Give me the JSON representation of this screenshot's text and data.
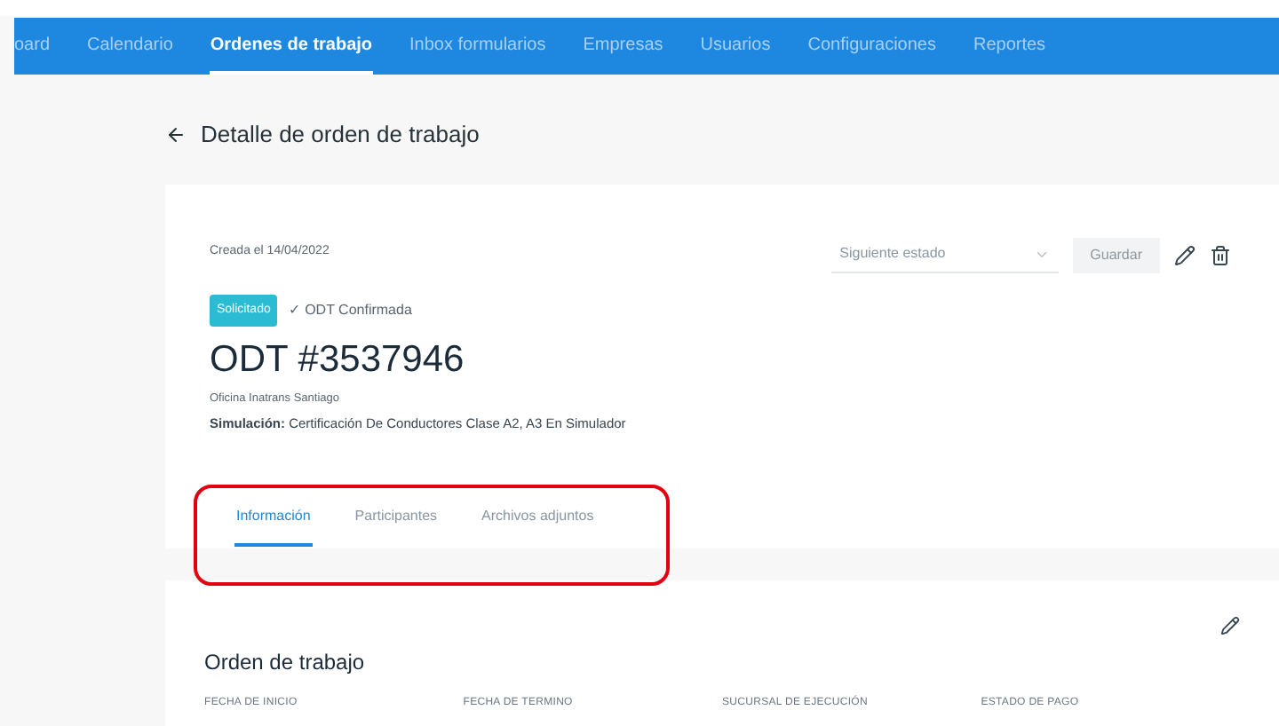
{
  "nav": {
    "items": [
      {
        "label": "oard",
        "selected": false
      },
      {
        "label": "Calendario",
        "selected": false
      },
      {
        "label": "Ordenes de trabajo",
        "selected": true
      },
      {
        "label": "Inbox formularios",
        "selected": false
      },
      {
        "label": "Empresas",
        "selected": false
      },
      {
        "label": "Usuarios",
        "selected": false
      },
      {
        "label": "Configuraciones",
        "selected": false
      },
      {
        "label": "Reportes",
        "selected": false
      }
    ]
  },
  "page_title": "Detalle de orden de trabajo",
  "order": {
    "created": "Creada el 14/04/2022",
    "status_badge": "Solicitado",
    "confirmation": "✓ ODT Confirmada",
    "number": "ODT #3537946",
    "office": "Oficina Inatrans Santiago",
    "simulation": "**Simulación:** Certificación De Conductores Clase A2, A3 En Simulador",
    "next_state": {
      "placeholder": "Siguiente estado"
    },
    "save_button": {
      "label": "Guardar",
      "disabled": true
    },
    "tabs": [
      {
        "label": "Información",
        "selected": true
      },
      {
        "label": "Participantes",
        "selected": false
      },
      {
        "label": "Archivos adjuntos",
        "selected": false
      }
    ]
  },
  "work_order": {
    "title": "Orden de trabajo",
    "fields": [
      "FECHA DE INICIO",
      "FECHA DE TERMINO",
      "SUCURSAL DE EJECUCIÓN",
      "ESTADO DE PAGO"
    ]
  }
}
